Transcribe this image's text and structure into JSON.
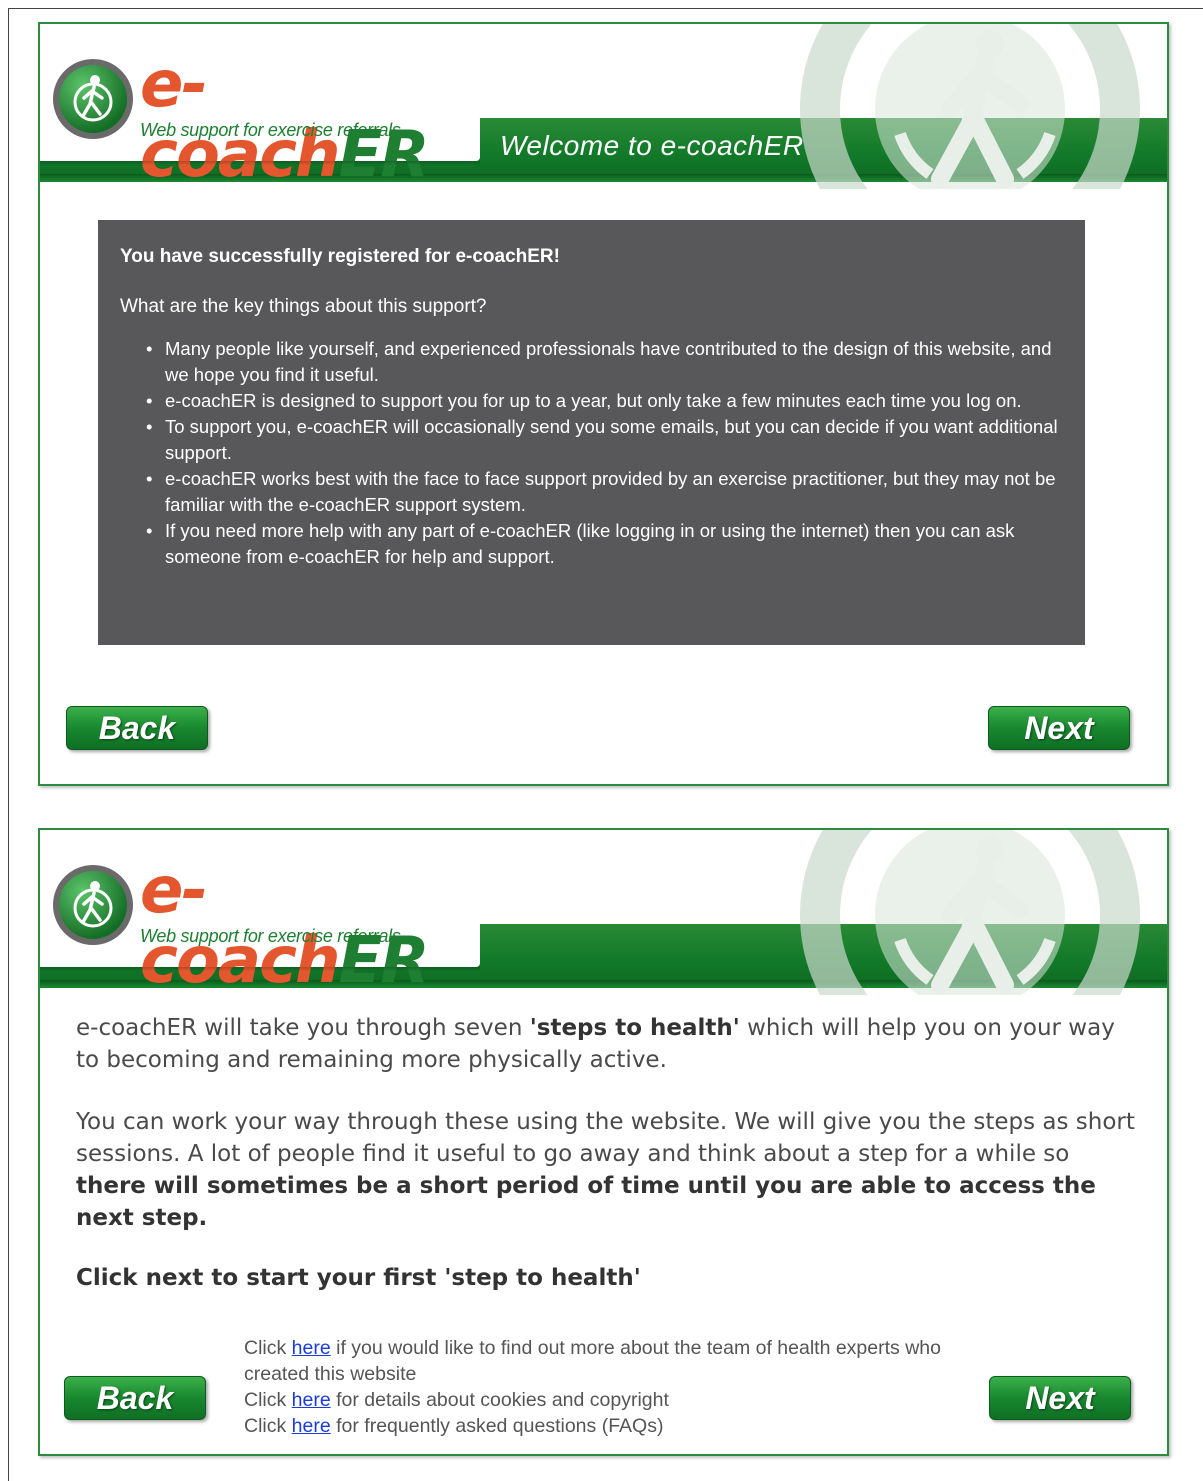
{
  "brand": {
    "name_prefix": "e-coach",
    "name_suffix": "ER",
    "tagline": "Web support for exercise referrals",
    "colors": {
      "green": "#1e7f33",
      "orange": "#e4572e",
      "dark_box": "#58585a"
    }
  },
  "screen1": {
    "header_title": "Welcome to e-coachER",
    "info": {
      "title": "You have successfully registered for e-coachER!",
      "question": "What are the key things about this support?",
      "bullets": [
        "Many people like yourself, and experienced professionals have contributed to the design of this website, and we hope you find it useful.",
        "e-coachER is designed to support you for up to a year, but only take a few minutes each time you log on.",
        "To support you, e-coachER will occasionally send you some emails, but you can decide if you want additional support.",
        "e-coachER works best with the face to face support provided by an exercise practitioner, but they may not be familiar with the e-coachER support system.",
        "If you need more help with any part of e-coachER (like logging in or using the internet) then you can ask someone from e-coachER for help and support."
      ]
    },
    "back_label": "Back",
    "next_label": "Next"
  },
  "screen2": {
    "intro_pre": "e-coachER will take you through seven ",
    "intro_bold": "'steps to health'",
    "intro_post": " which will help you on your way to becoming and remaining more physically active.",
    "para_pre": "You can work your way through these using the website. We will give you the steps as short sessions. A lot of people find it useful to go away and think about a step for a while so ",
    "para_bold": "there will sometimes be a short period of time until you are able to access the next step.",
    "cta": "Click next to start your first 'step to health'",
    "links": [
      {
        "pre": "Click ",
        "link": "here",
        "post": " if you would like to find out more about the team of health experts who created this website"
      },
      {
        "pre": "Click ",
        "link": "here",
        "post": " for details about cookies and copyright"
      },
      {
        "pre": "Click ",
        "link": "here",
        "post": " for frequently asked questions (FAQs)"
      }
    ],
    "back_label": "Back",
    "next_label": "Next"
  }
}
